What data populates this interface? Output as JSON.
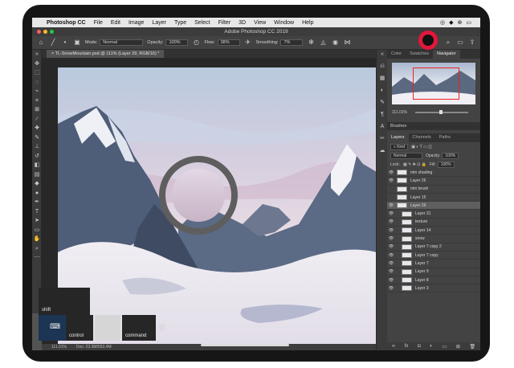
{
  "menubar": {
    "apple": "",
    "app_name": "Photoshop CC",
    "items": [
      "File",
      "Edit",
      "Image",
      "Layer",
      "Type",
      "Select",
      "Filter",
      "3D",
      "View",
      "Window",
      "Help"
    ]
  },
  "window": {
    "title": "Adobe Photoshop CC 2019"
  },
  "options_bar": {
    "mode_label": "Mode:",
    "mode_value": "Normal",
    "opacity_label": "Opacity:",
    "opacity_value": "100%",
    "flow_label": "Flow:",
    "flow_value": "38%",
    "smoothing_label": "Smoothing:",
    "smoothing_value": "7%"
  },
  "document_tab": {
    "label": "TL-SnowMountain.psd @ 111% (Layer 29, RGB/16) *"
  },
  "panels": {
    "top_tabs": [
      "Color",
      "Swatches",
      "Navigator"
    ],
    "active_top_tab": "Navigator",
    "navigator_zoom": "111.01%",
    "brushes_header": "Brushes",
    "layer_tabs": [
      "Layers",
      "Channels",
      "Paths"
    ],
    "kind_label": "Kind",
    "blend_mode": "Normal",
    "opacity_label": "Opacity:",
    "opacity_value": "100%",
    "lock_label": "Lock:",
    "fill_label": "Fill:",
    "fill_value": "100%",
    "layers": [
      {
        "name": "mtn shading",
        "visible": true,
        "selected": false,
        "indent": false
      },
      {
        "name": "Layer 26",
        "visible": true,
        "selected": false,
        "indent": false
      },
      {
        "name": "mtn brush",
        "visible": false,
        "selected": false,
        "indent": false
      },
      {
        "name": "Layer 15",
        "visible": false,
        "selected": false,
        "indent": false
      },
      {
        "name": "Layer 29",
        "visible": true,
        "selected": true,
        "indent": false
      },
      {
        "name": "Layer 31",
        "visible": true,
        "selected": false,
        "indent": true
      },
      {
        "name": "texture",
        "visible": true,
        "selected": false,
        "indent": true
      },
      {
        "name": "Layer 14",
        "visible": true,
        "selected": false,
        "indent": true
      },
      {
        "name": "snow",
        "visible": true,
        "selected": false,
        "indent": true
      },
      {
        "name": "Layer 7 copy 2",
        "visible": true,
        "selected": false,
        "indent": true
      },
      {
        "name": "Layer 7 copy",
        "visible": true,
        "selected": false,
        "indent": true
      },
      {
        "name": "Layer 7",
        "visible": true,
        "selected": false,
        "indent": true
      },
      {
        "name": "Layer 9",
        "visible": true,
        "selected": false,
        "indent": true
      },
      {
        "name": "Layer 8",
        "visible": true,
        "selected": false,
        "indent": true
      },
      {
        "name": "Layer 3",
        "visible": true,
        "selected": false,
        "indent": true
      }
    ]
  },
  "status_bar": {
    "zoom": "111.01%",
    "doc_info": "Doc: 23.3M/553.4M"
  },
  "touch_shortcuts": {
    "shift": "shift",
    "control": "control",
    "command": "command"
  },
  "colors": {
    "record_button": "#e3163a",
    "ps_dark": "#535353"
  }
}
